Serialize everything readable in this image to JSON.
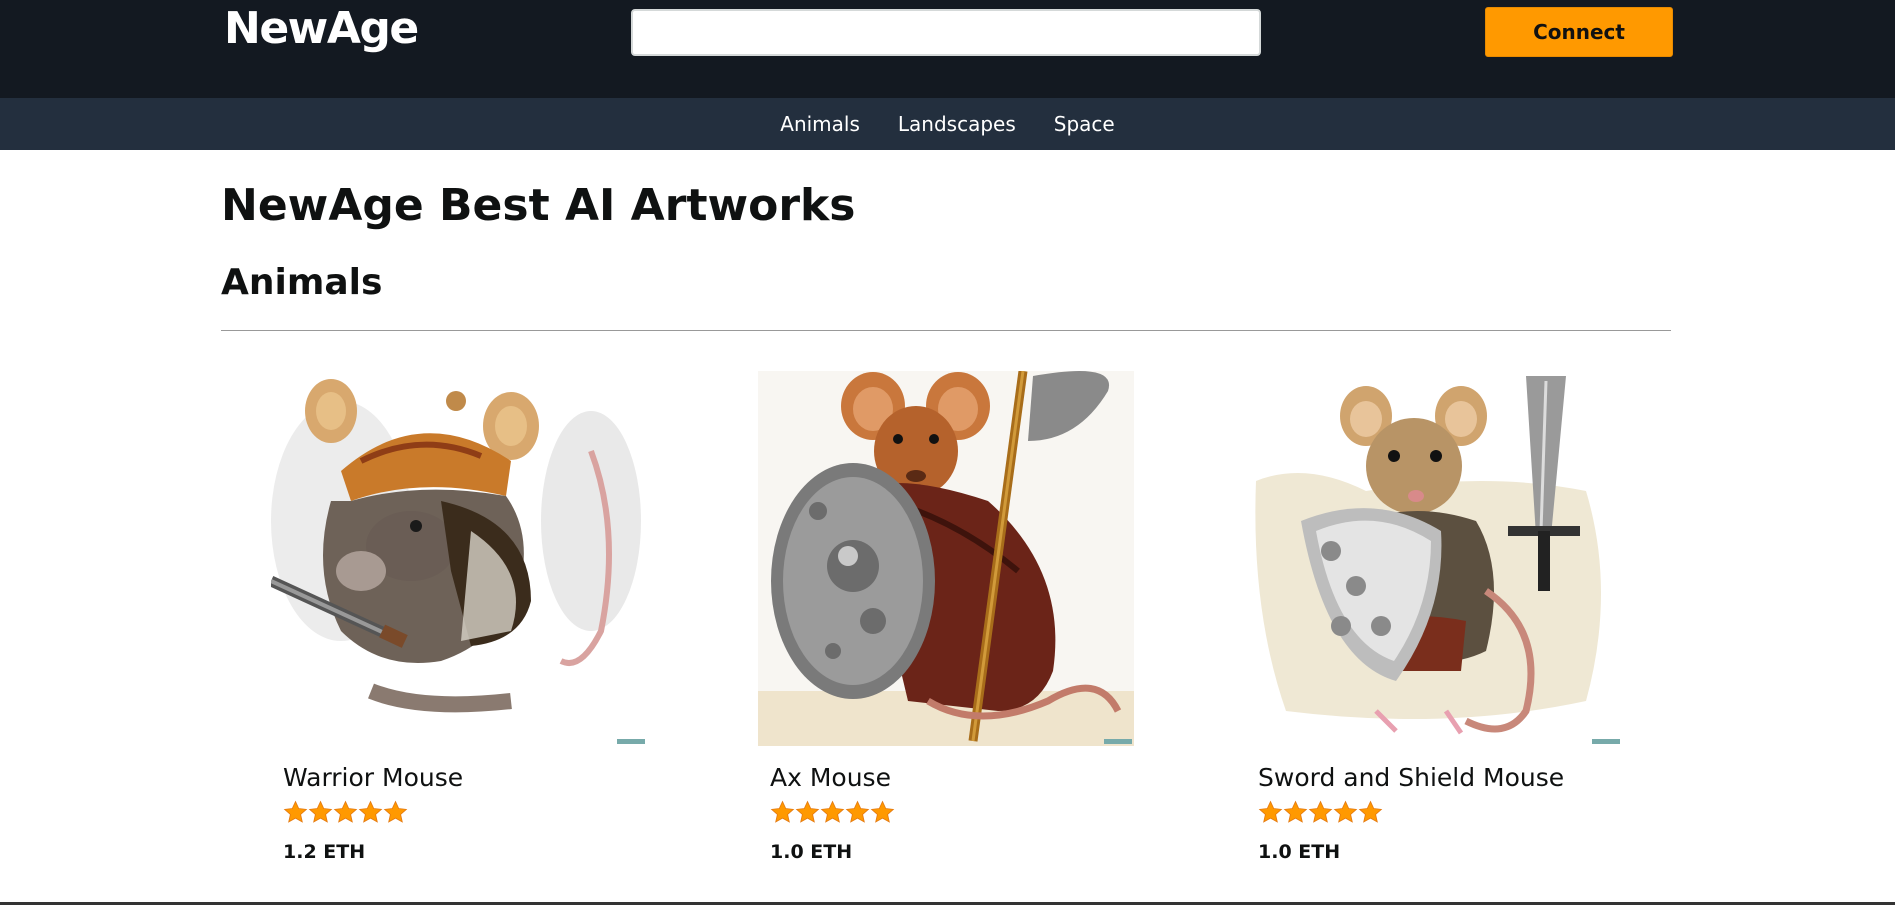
{
  "header": {
    "logo": "NewAge",
    "search_placeholder": "",
    "connect_label": "Connect"
  },
  "nav": {
    "items": [
      "Animals",
      "Landscapes",
      "Space"
    ]
  },
  "main": {
    "title": "NewAge Best AI Artworks",
    "section_title": "Animals",
    "products": [
      {
        "name": "Warrior Mouse",
        "rating": 5,
        "price": "1.2 ETH",
        "image": "warrior-mouse-image"
      },
      {
        "name": "Ax Mouse",
        "rating": 5,
        "price": "1.0 ETH",
        "image": "ax-mouse-image"
      },
      {
        "name": "Sword and Shield Mouse",
        "rating": 5,
        "price": "1.0 ETH",
        "image": "sword-shield-mouse-image"
      }
    ]
  },
  "colors": {
    "topbar": "#131921",
    "navbar": "#232f3e",
    "accent": "#ff9900",
    "star": "#ff9900"
  }
}
